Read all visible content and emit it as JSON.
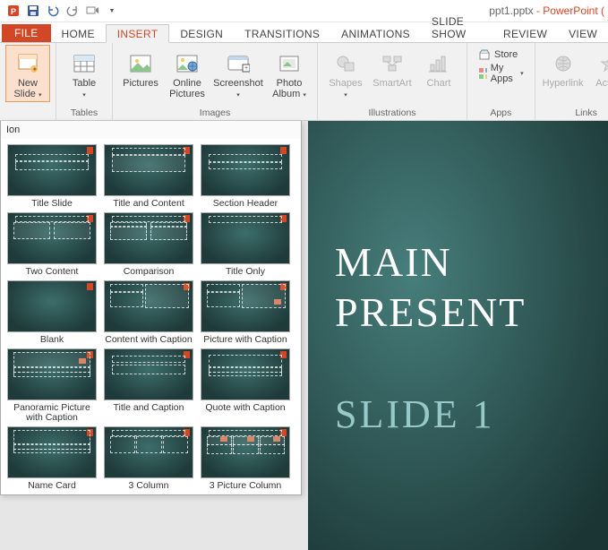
{
  "titlebar": {
    "filename": "ppt1.pptx",
    "sep": " - ",
    "app": "PowerPoint ("
  },
  "tabs": {
    "file": "FILE",
    "home": "HOME",
    "insert": "INSERT",
    "design": "DESIGN",
    "transitions": "TRANSITIONS",
    "animations": "ANIMATIONS",
    "slideshow": "SLIDE SHOW",
    "review": "REVIEW",
    "view": "VIEW"
  },
  "ribbon": {
    "newslide": "New\nSlide",
    "table": "Table",
    "pictures": "Pictures",
    "onlinepics": "Online\nPictures",
    "screenshot": "Screenshot",
    "photoalbum": "Photo\nAlbum",
    "shapes": "Shapes",
    "smartart": "SmartArt",
    "chart": "Chart",
    "store": "Store",
    "myapps": "My Apps",
    "hyperlink": "Hyperlink",
    "action": "Action",
    "g_slides": "",
    "g_tables": "Tables",
    "g_images": "Images",
    "g_illus": "Illustrations",
    "g_apps": "Apps",
    "g_links": "Links"
  },
  "gallery": {
    "theme": "Ion",
    "layouts": [
      {
        "label": "Title Slide",
        "id": "title-slide"
      },
      {
        "label": "Title and Content",
        "id": "title-content"
      },
      {
        "label": "Section Header",
        "id": "section-header"
      },
      {
        "label": "Two Content",
        "id": "two-content"
      },
      {
        "label": "Comparison",
        "id": "comparison"
      },
      {
        "label": "Title Only",
        "id": "title-only"
      },
      {
        "label": "Blank",
        "id": "blank"
      },
      {
        "label": "Content with Caption",
        "id": "content-caption"
      },
      {
        "label": "Picture with Caption",
        "id": "picture-caption"
      },
      {
        "label": "Panoramic Picture with Caption",
        "id": "panoramic"
      },
      {
        "label": "Title and Caption",
        "id": "title-caption"
      },
      {
        "label": "Quote with Caption",
        "id": "quote-caption"
      },
      {
        "label": "Name Card",
        "id": "name-card"
      },
      {
        "label": "3 Column",
        "id": "3-column"
      },
      {
        "label": "3 Picture Column",
        "id": "3-picture-column"
      }
    ]
  },
  "slide": {
    "line1": "MAIN",
    "line2": "PRESENT",
    "sub": "SLIDE 1"
  }
}
